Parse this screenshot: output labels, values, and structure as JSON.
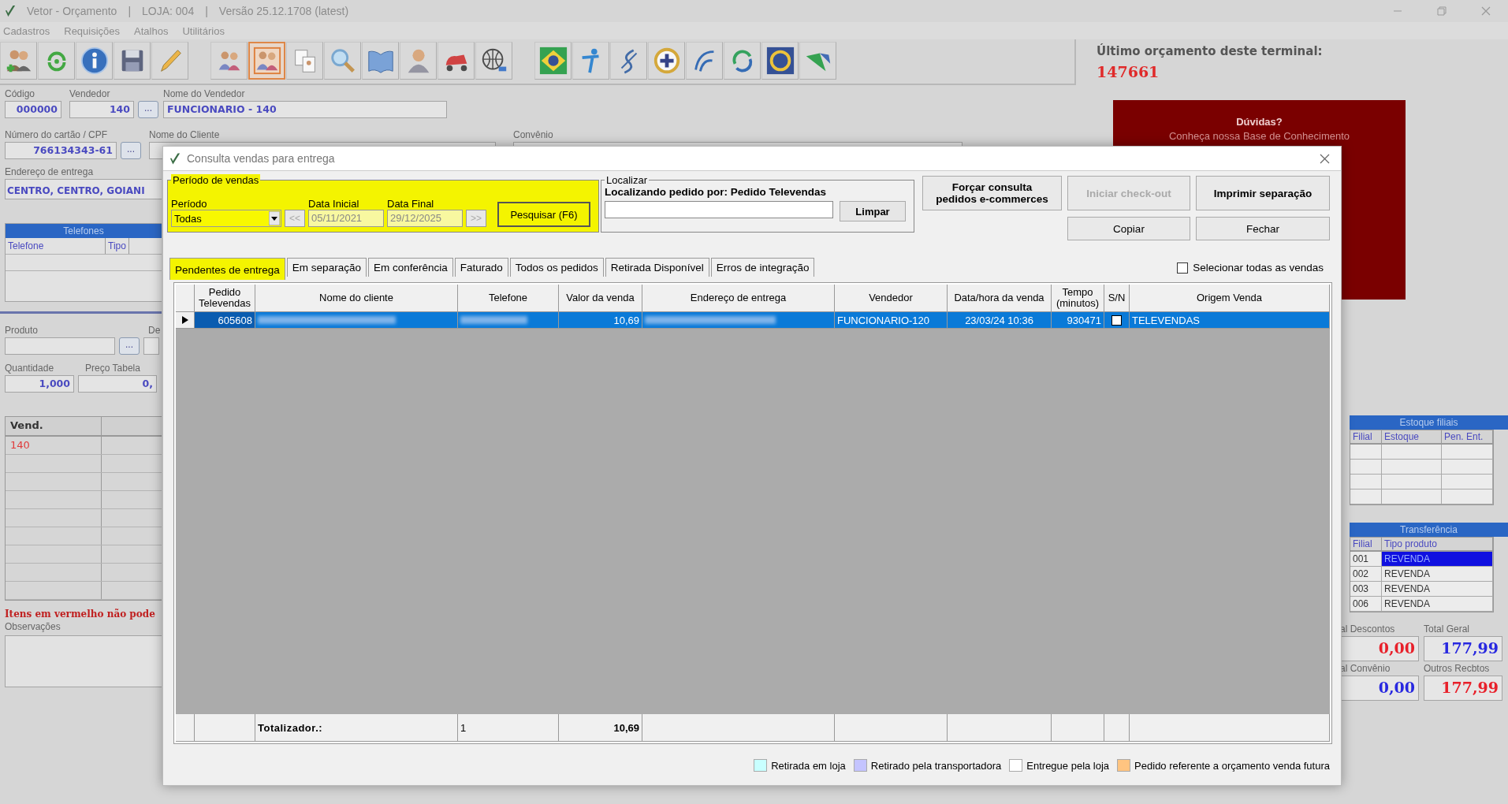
{
  "window": {
    "title_parts": [
      "Vetor - Orçamento",
      "|",
      "LOJA: 004",
      "|",
      "Versão 25.12.1708 (latest)"
    ]
  },
  "menu": [
    "Cadastros",
    "Requisições",
    "Atalhos",
    "Utilitários"
  ],
  "toolbar_groups": [
    [
      {
        "kind": "people-add",
        "selected": false
      },
      {
        "kind": "sync",
        "selected": false
      },
      {
        "kind": "info",
        "selected": false
      },
      {
        "kind": "save",
        "selected": false
      },
      {
        "kind": "pencil",
        "selected": false
      }
    ],
    [
      {
        "kind": "people",
        "selected": false
      },
      {
        "kind": "people-pair",
        "selected": true
      },
      {
        "kind": "documents",
        "selected": false
      },
      {
        "kind": "search",
        "selected": false
      },
      {
        "kind": "book",
        "selected": false
      },
      {
        "kind": "person",
        "selected": false
      },
      {
        "kind": "scooter",
        "selected": false
      },
      {
        "kind": "globe",
        "selected": false
      }
    ],
    [
      {
        "kind": "flag",
        "selected": false
      },
      {
        "kind": "figure",
        "selected": false
      },
      {
        "kind": "hook",
        "selected": false
      },
      {
        "kind": "plus-circle",
        "selected": false
      },
      {
        "kind": "curve",
        "selected": false
      },
      {
        "kind": "refresh",
        "selected": false
      },
      {
        "kind": "ring",
        "selected": false
      },
      {
        "kind": "chevron",
        "selected": false
      }
    ]
  ],
  "last_budget": {
    "label": "Último orçamento deste terminal:",
    "number": "147661"
  },
  "help_banner": {
    "title": "Dúvidas?",
    "text": "Conheça nossa Base de Conhecimento"
  },
  "form": {
    "codigo": {
      "label": "Código",
      "value": "000000"
    },
    "vendedor": {
      "label": "Vendedor",
      "value": "140",
      "button": "..."
    },
    "nome_vendedor": {
      "label": "Nome do Vendedor",
      "value": "FUNCIONARIO - 140"
    },
    "cartao": {
      "label": "Número do cartão / CPF",
      "value": "766134343-61",
      "button": "..."
    },
    "nome_cliente": {
      "label": "Nome do Cliente"
    },
    "convenio": {
      "label": "Convênio"
    },
    "endereco": {
      "label": "Endereço de entrega",
      "value": "CENTRO, CENTRO, GOIANI"
    }
  },
  "phones": {
    "title": "Telefones",
    "columns": [
      "Telefone",
      "Tipo"
    ]
  },
  "product": {
    "label": "Produto",
    "button": "...",
    "desc_label": "De",
    "qty_label": "Quantidade",
    "qty": "1,000",
    "price_label": "Preço Tabela",
    "price": "0,"
  },
  "items": {
    "column": "Vend.",
    "rows": [
      "140"
    ],
    "warning": "Itens em vermelho não pode",
    "notes_label": "Observações"
  },
  "branch_stock": {
    "title": "Estoque filiais",
    "columns": [
      "Filial",
      "Estoque",
      "Pen. Ent."
    ]
  },
  "transfer": {
    "title": "Transferência",
    "columns": [
      "Filial",
      "Tipo produto"
    ],
    "rows": [
      {
        "filial": "001",
        "tipo": "REVENDA",
        "selected": true
      },
      {
        "filial": "002",
        "tipo": "REVENDA",
        "selected": false
      },
      {
        "filial": "003",
        "tipo": "REVENDA",
        "selected": false
      },
      {
        "filial": "006",
        "tipo": "REVENDA",
        "selected": false
      }
    ]
  },
  "totals": [
    {
      "label": "al Descontos",
      "value": "0,00",
      "color": "#e8202a"
    },
    {
      "label": "Total Geral",
      "value": "177,99",
      "color": "#2828e0"
    },
    {
      "label": "al Convênio",
      "value": "0,00",
      "color": "#2828e0"
    },
    {
      "label": "Outros Recbtos",
      "value": "177,99",
      "color": "#e8202a"
    }
  ],
  "dialog": {
    "title": "Consulta vendas para entrega",
    "period": {
      "legend": "Período de vendas",
      "period_label": "Período",
      "period_value": "Todas",
      "prev": "<<",
      "next": ">>",
      "nav_disabled": true,
      "start_label": "Data Inicial",
      "start_value": "05/11/2021",
      "end_label": "Data Final",
      "end_value": "29/12/2025",
      "dates_disabled": true,
      "search": "Pesquisar (F6)"
    },
    "locate": {
      "legend": "Localizar",
      "caption": "Localizando pedido por: Pedido Televendas",
      "clear": "Limpar"
    },
    "buttons": [
      {
        "label": "Forçar consulta\npedidos e-commerces",
        "kind": "bold",
        "disabled": false
      },
      {
        "label": "Iniciar check-out",
        "kind": "bold",
        "disabled": true
      },
      {
        "label": "Imprimir separação",
        "kind": "bold",
        "disabled": false
      },
      {
        "label": "Copiar",
        "kind": "plain",
        "disabled": false
      },
      {
        "label": "Fechar",
        "kind": "plain",
        "disabled": false
      }
    ],
    "tabs": [
      {
        "label": "Pendentes de entrega",
        "selected": true
      },
      {
        "label": "Em separação",
        "selected": false
      },
      {
        "label": "Em conferência",
        "selected": false
      },
      {
        "label": "Faturado",
        "selected": false
      },
      {
        "label": "Todos os pedidos",
        "selected": false
      },
      {
        "label": "Retirada Disponível",
        "selected": false
      },
      {
        "label": "Erros de integração",
        "selected": false
      }
    ],
    "select_all": {
      "label": "Selecionar todas as vendas",
      "checked": false
    },
    "table": {
      "columns": [
        "Pedido\nTelevendas",
        "Nome do cliente",
        "Telefone",
        "Valor da venda",
        "Endereço de entrega",
        "Vendedor",
        "Data/hora da venda",
        "Tempo\n(minutos)",
        "S/N",
        "Origem Venda"
      ],
      "rows": [
        {
          "current": true,
          "selected": true,
          "cells": [
            {
              "kind": "text",
              "text": "605608"
            },
            {
              "kind": "blurred"
            },
            {
              "kind": "blurred"
            },
            {
              "kind": "text",
              "text": "10,69"
            },
            {
              "kind": "blurred"
            },
            {
              "kind": "text",
              "text": "FUNCIONARIO-120"
            },
            {
              "kind": "text",
              "text": "23/03/24 10:36"
            },
            {
              "kind": "text",
              "text": "930471"
            },
            {
              "kind": "checkbox",
              "checked": false
            },
            {
              "kind": "text",
              "text": "TELEVENDAS"
            }
          ]
        }
      ],
      "footer": [
        {
          "kind": "empty"
        },
        {
          "kind": "text",
          "text": "Totalizador.:"
        },
        {
          "kind": "text",
          "text": "1"
        },
        {
          "kind": "text",
          "text": "10,69"
        },
        {
          "kind": "empty"
        },
        {
          "kind": "empty"
        },
        {
          "kind": "empty"
        },
        {
          "kind": "empty"
        },
        {
          "kind": "empty"
        },
        {
          "kind": "empty"
        }
      ]
    },
    "legend": [
      {
        "label": "Retirada em loja",
        "color": "#c8ffff"
      },
      {
        "label": "Retirado pela transportadora",
        "color": "#c4c4ff"
      },
      {
        "label": "Entregue pela loja",
        "color": "#ffffff"
      },
      {
        "label": "Pedido referente a orçamento venda futura",
        "color": "#ffc480"
      }
    ]
  }
}
